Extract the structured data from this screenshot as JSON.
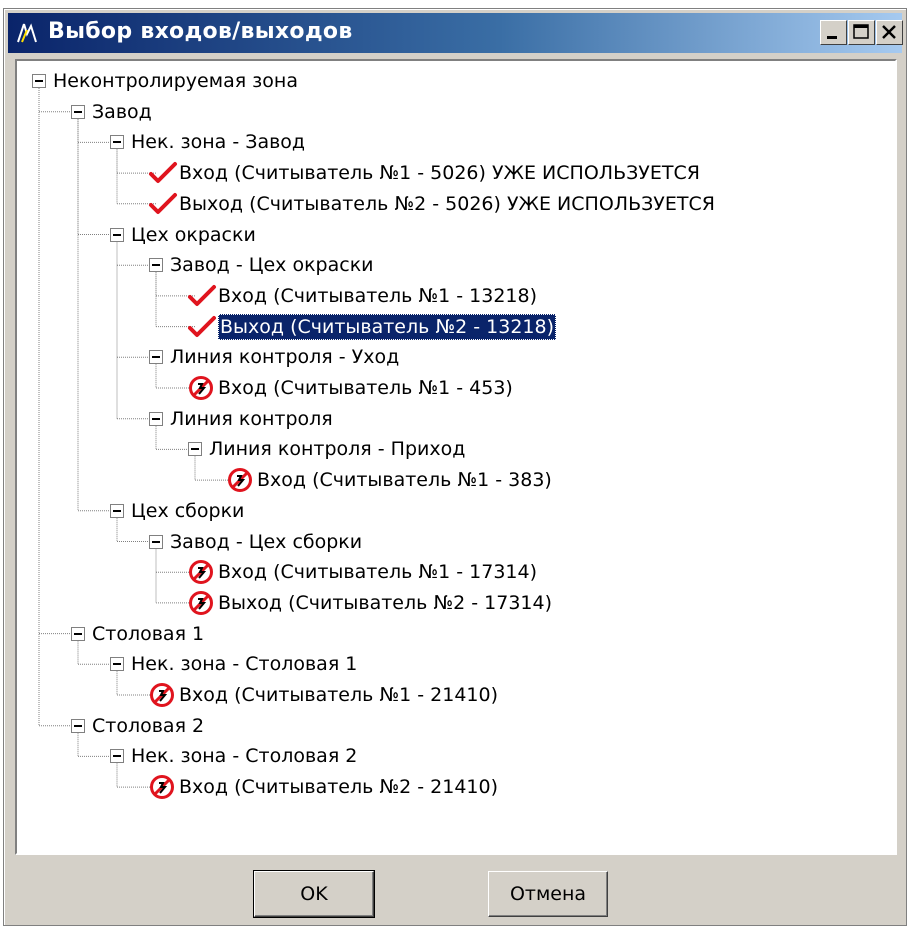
{
  "window": {
    "title": "Выбор входов/выходов",
    "colors": {
      "titlebar_start": "#0a246a",
      "titlebar_end": "#a6caf0",
      "face": "#d4d0c8",
      "selection": "#0a246a"
    }
  },
  "tree": [
    {
      "label": "Неконтролируемая зона",
      "level": 0,
      "expander": true,
      "icon": null
    },
    {
      "label": "Завод",
      "level": 1,
      "expander": true,
      "icon": null
    },
    {
      "label": "Нек. зона - Завод",
      "level": 2,
      "expander": true,
      "icon": null
    },
    {
      "label": "Вход (Считыватель №1 - 5026) УЖЕ ИСПОЛЬЗУЕТСЯ",
      "level": 3,
      "expander": false,
      "icon": "checkmark-icon"
    },
    {
      "label": "Выход (Считыватель №2 - 5026) УЖЕ ИСПОЛЬЗУЕТСЯ",
      "level": 3,
      "expander": false,
      "icon": "checkmark-icon"
    },
    {
      "label": "Цех окраски",
      "level": 2,
      "expander": true,
      "icon": null
    },
    {
      "label": "Завод - Цех окраски",
      "level": 3,
      "expander": true,
      "icon": null
    },
    {
      "label": "Вход (Считыватель №1 - 13218)",
      "level": 4,
      "expander": false,
      "icon": "checkmark-icon"
    },
    {
      "label": "Выход (Считыватель №2 - 13218)",
      "level": 4,
      "expander": false,
      "icon": "checkmark-icon",
      "selected": true
    },
    {
      "label": "Линия контроля - Уход",
      "level": 3,
      "expander": true,
      "icon": null
    },
    {
      "label": "Вход (Считыватель №1 - 453)",
      "level": 4,
      "expander": false,
      "icon": "unavailable-icon"
    },
    {
      "label": "Линия контроля",
      "level": 3,
      "expander": true,
      "icon": null
    },
    {
      "label": "Линия контроля - Приход",
      "level": 4,
      "expander": true,
      "icon": null
    },
    {
      "label": "Вход (Считыватель №1 - 383)",
      "level": 5,
      "expander": false,
      "icon": "unavailable-icon"
    },
    {
      "label": "Цех сборки",
      "level": 2,
      "expander": true,
      "icon": null
    },
    {
      "label": "Завод - Цех сборки",
      "level": 3,
      "expander": true,
      "icon": null
    },
    {
      "label": "Вход (Считыватель №1 - 17314)",
      "level": 4,
      "expander": false,
      "icon": "unavailable-icon"
    },
    {
      "label": "Выход (Считыватель №2 - 17314)",
      "level": 4,
      "expander": false,
      "icon": "unavailable-icon"
    },
    {
      "label": "Столовая 1",
      "level": 1,
      "expander": true,
      "icon": null
    },
    {
      "label": "Нек. зона - Столовая 1",
      "level": 2,
      "expander": true,
      "icon": null
    },
    {
      "label": "Вход (Считыватель №1 - 21410)",
      "level": 3,
      "expander": false,
      "icon": "unavailable-icon"
    },
    {
      "label": "Столовая 2",
      "level": 1,
      "expander": true,
      "icon": null
    },
    {
      "label": "Нек. зона - Столовая 2",
      "level": 2,
      "expander": true,
      "icon": null
    },
    {
      "label": "Вход (Считыватель №2 - 21410)",
      "level": 3,
      "expander": false,
      "icon": "unavailable-icon"
    }
  ],
  "buttons": {
    "ok": "OK",
    "cancel": "Отмена"
  }
}
